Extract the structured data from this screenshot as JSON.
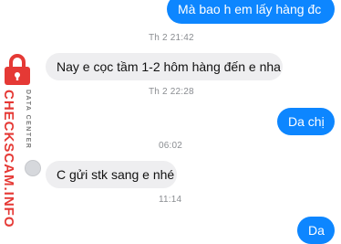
{
  "messages": [
    {
      "text": "Mà bao h em lấy hàng đc"
    },
    {
      "text": "Nay e cọc tầm 1-2 hôm hàng đến e nha"
    },
    {
      "text": "Da chị"
    },
    {
      "text": "C gửi stk sang e nhé"
    },
    {
      "text": "Da"
    }
  ],
  "timestamps": [
    "Th 2 21:42",
    "Th 2 22:28",
    "06:02",
    "11:14"
  ],
  "watermark": {
    "brand": "CHECKSCAM.INFO",
    "tagline": "DATA CENTER"
  },
  "colors": {
    "outgoing": "#0d86ff",
    "incoming": "#eeeef0",
    "watermark": "#e53935"
  },
  "icons": {
    "watermark_logo": "lock-icon"
  }
}
